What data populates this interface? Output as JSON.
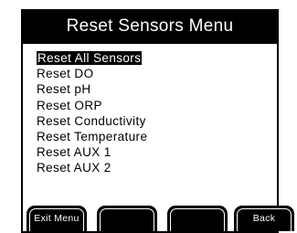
{
  "header": {
    "title": "Reset Sensors Menu"
  },
  "menu": {
    "items": [
      {
        "label": "Reset All Sensors",
        "selected": true
      },
      {
        "label": "Reset DO",
        "selected": false
      },
      {
        "label": "Reset pH",
        "selected": false
      },
      {
        "label": "Reset ORP",
        "selected": false
      },
      {
        "label": "Reset Conductivity",
        "selected": false
      },
      {
        "label": "Reset Temperature",
        "selected": false
      },
      {
        "label": "Reset AUX 1",
        "selected": false
      },
      {
        "label": "Reset AUX 2",
        "selected": false
      }
    ]
  },
  "softkeys": {
    "key1": "Exit Menu",
    "key2": "",
    "key3": "",
    "key4": "Back"
  },
  "colors": {
    "background": "#ffffff",
    "foreground": "#000000",
    "highlight_bg": "#000000",
    "highlight_fg": "#ffffff"
  }
}
